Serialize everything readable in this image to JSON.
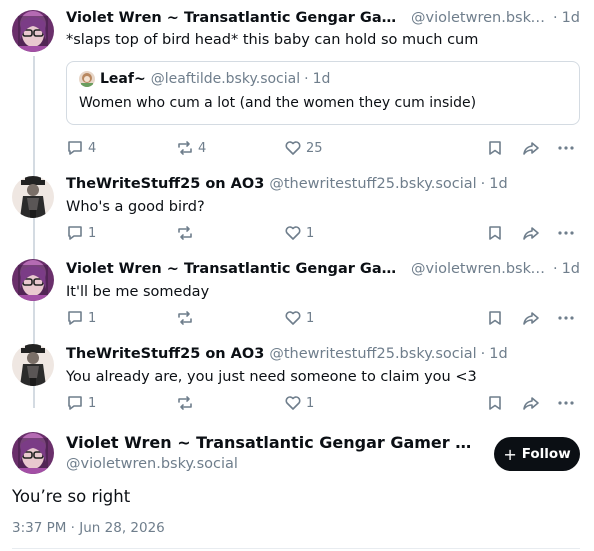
{
  "posts": [
    {
      "name": "Violet Wren ~ Transatlantic Gengar Gamer Gi...",
      "handle": "@violetwren.bsky...",
      "dot": "·",
      "time": "1d",
      "text": "*slaps top of bird head* this baby can hold so much cum",
      "quote": {
        "name": "Leaf~",
        "handle": "@leaftilde.bsky.social",
        "dot": "·",
        "time": "1d",
        "text": "Women who cum a lot (and the women they cum inside)"
      },
      "replies": "4",
      "reposts": "4",
      "likes": "25"
    },
    {
      "name": "TheWriteStuff25 on AO3",
      "handle": "@thewritestuff25.bsky.social",
      "dot": "·",
      "time": "1d",
      "text": "Who's a good bird?",
      "replies": "1",
      "reposts": "",
      "likes": "1"
    },
    {
      "name": "Violet Wren ~ Transatlantic Gengar Gamer Gi...",
      "handle": "@violetwren.bsky...",
      "dot": "·",
      "time": "1d",
      "text": "It'll be me someday",
      "replies": "1",
      "reposts": "",
      "likes": "1"
    },
    {
      "name": "TheWriteStuff25 on AO3",
      "handle": "@thewritestuff25.bsky.social",
      "dot": "·",
      "time": "1d",
      "text": "You already are, you just need someone to claim you <3",
      "replies": "1",
      "reposts": "",
      "likes": "1"
    }
  ],
  "main": {
    "name": "Violet Wren ~ Transatlantic Gengar Gamer Girlfri...",
    "handle": "@violetwren.bsky.social",
    "follow_plus": "+",
    "follow_label": "Follow",
    "text": "You’re so right",
    "timestamp": "3:37 PM · Jun 28, 2026"
  },
  "colors": {
    "text": "#0b0f14",
    "muted": "#6f7e8c",
    "thread_line": "#d4dbe2",
    "follow_bg": "#0b0f14"
  },
  "icons": [
    "reply-icon",
    "repost-icon",
    "like-icon",
    "bookmark-icon",
    "share-icon",
    "more-icon"
  ]
}
